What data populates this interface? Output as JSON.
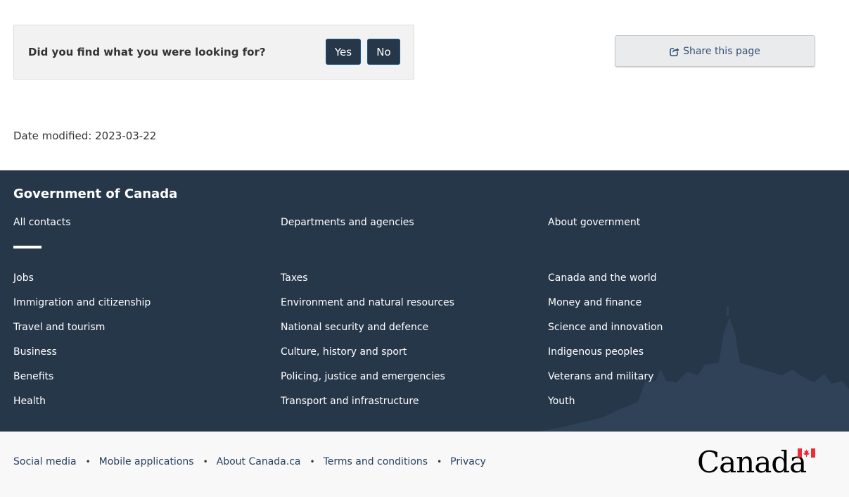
{
  "feedback": {
    "question": "Did you find what you were looking for?",
    "yes_label": "Yes",
    "no_label": "No"
  },
  "share": {
    "label": "Share this page",
    "icon": "share-icon"
  },
  "date_modified": {
    "text": "Date modified: 2023-03-22"
  },
  "footer": {
    "title": "Government of Canada",
    "contacts": [
      "All contacts",
      "Departments and agencies",
      "About government"
    ],
    "columns": [
      [
        "Jobs",
        "Immigration and citizenship",
        "Travel and tourism",
        "Business",
        "Benefits",
        "Health"
      ],
      [
        "Taxes",
        "Environment and natural resources",
        "National security and defence",
        "Culture, history and sport",
        "Policing, justice and emergencies",
        "Transport and infrastructure"
      ],
      [
        "Canada and the world",
        "Money and finance",
        "Science and innovation",
        "Indigenous peoples",
        "Veterans and military",
        "Youth"
      ]
    ]
  },
  "bottom_links": [
    "Social media",
    "Mobile applications",
    "About Canada.ca",
    "Terms and conditions",
    "Privacy"
  ],
  "wordmark": {
    "text": "Canada"
  },
  "colors": {
    "footer_bg": "#26374a",
    "button_bg": "#26374a",
    "link": "#284162",
    "flag_red": "#eb2d37"
  }
}
